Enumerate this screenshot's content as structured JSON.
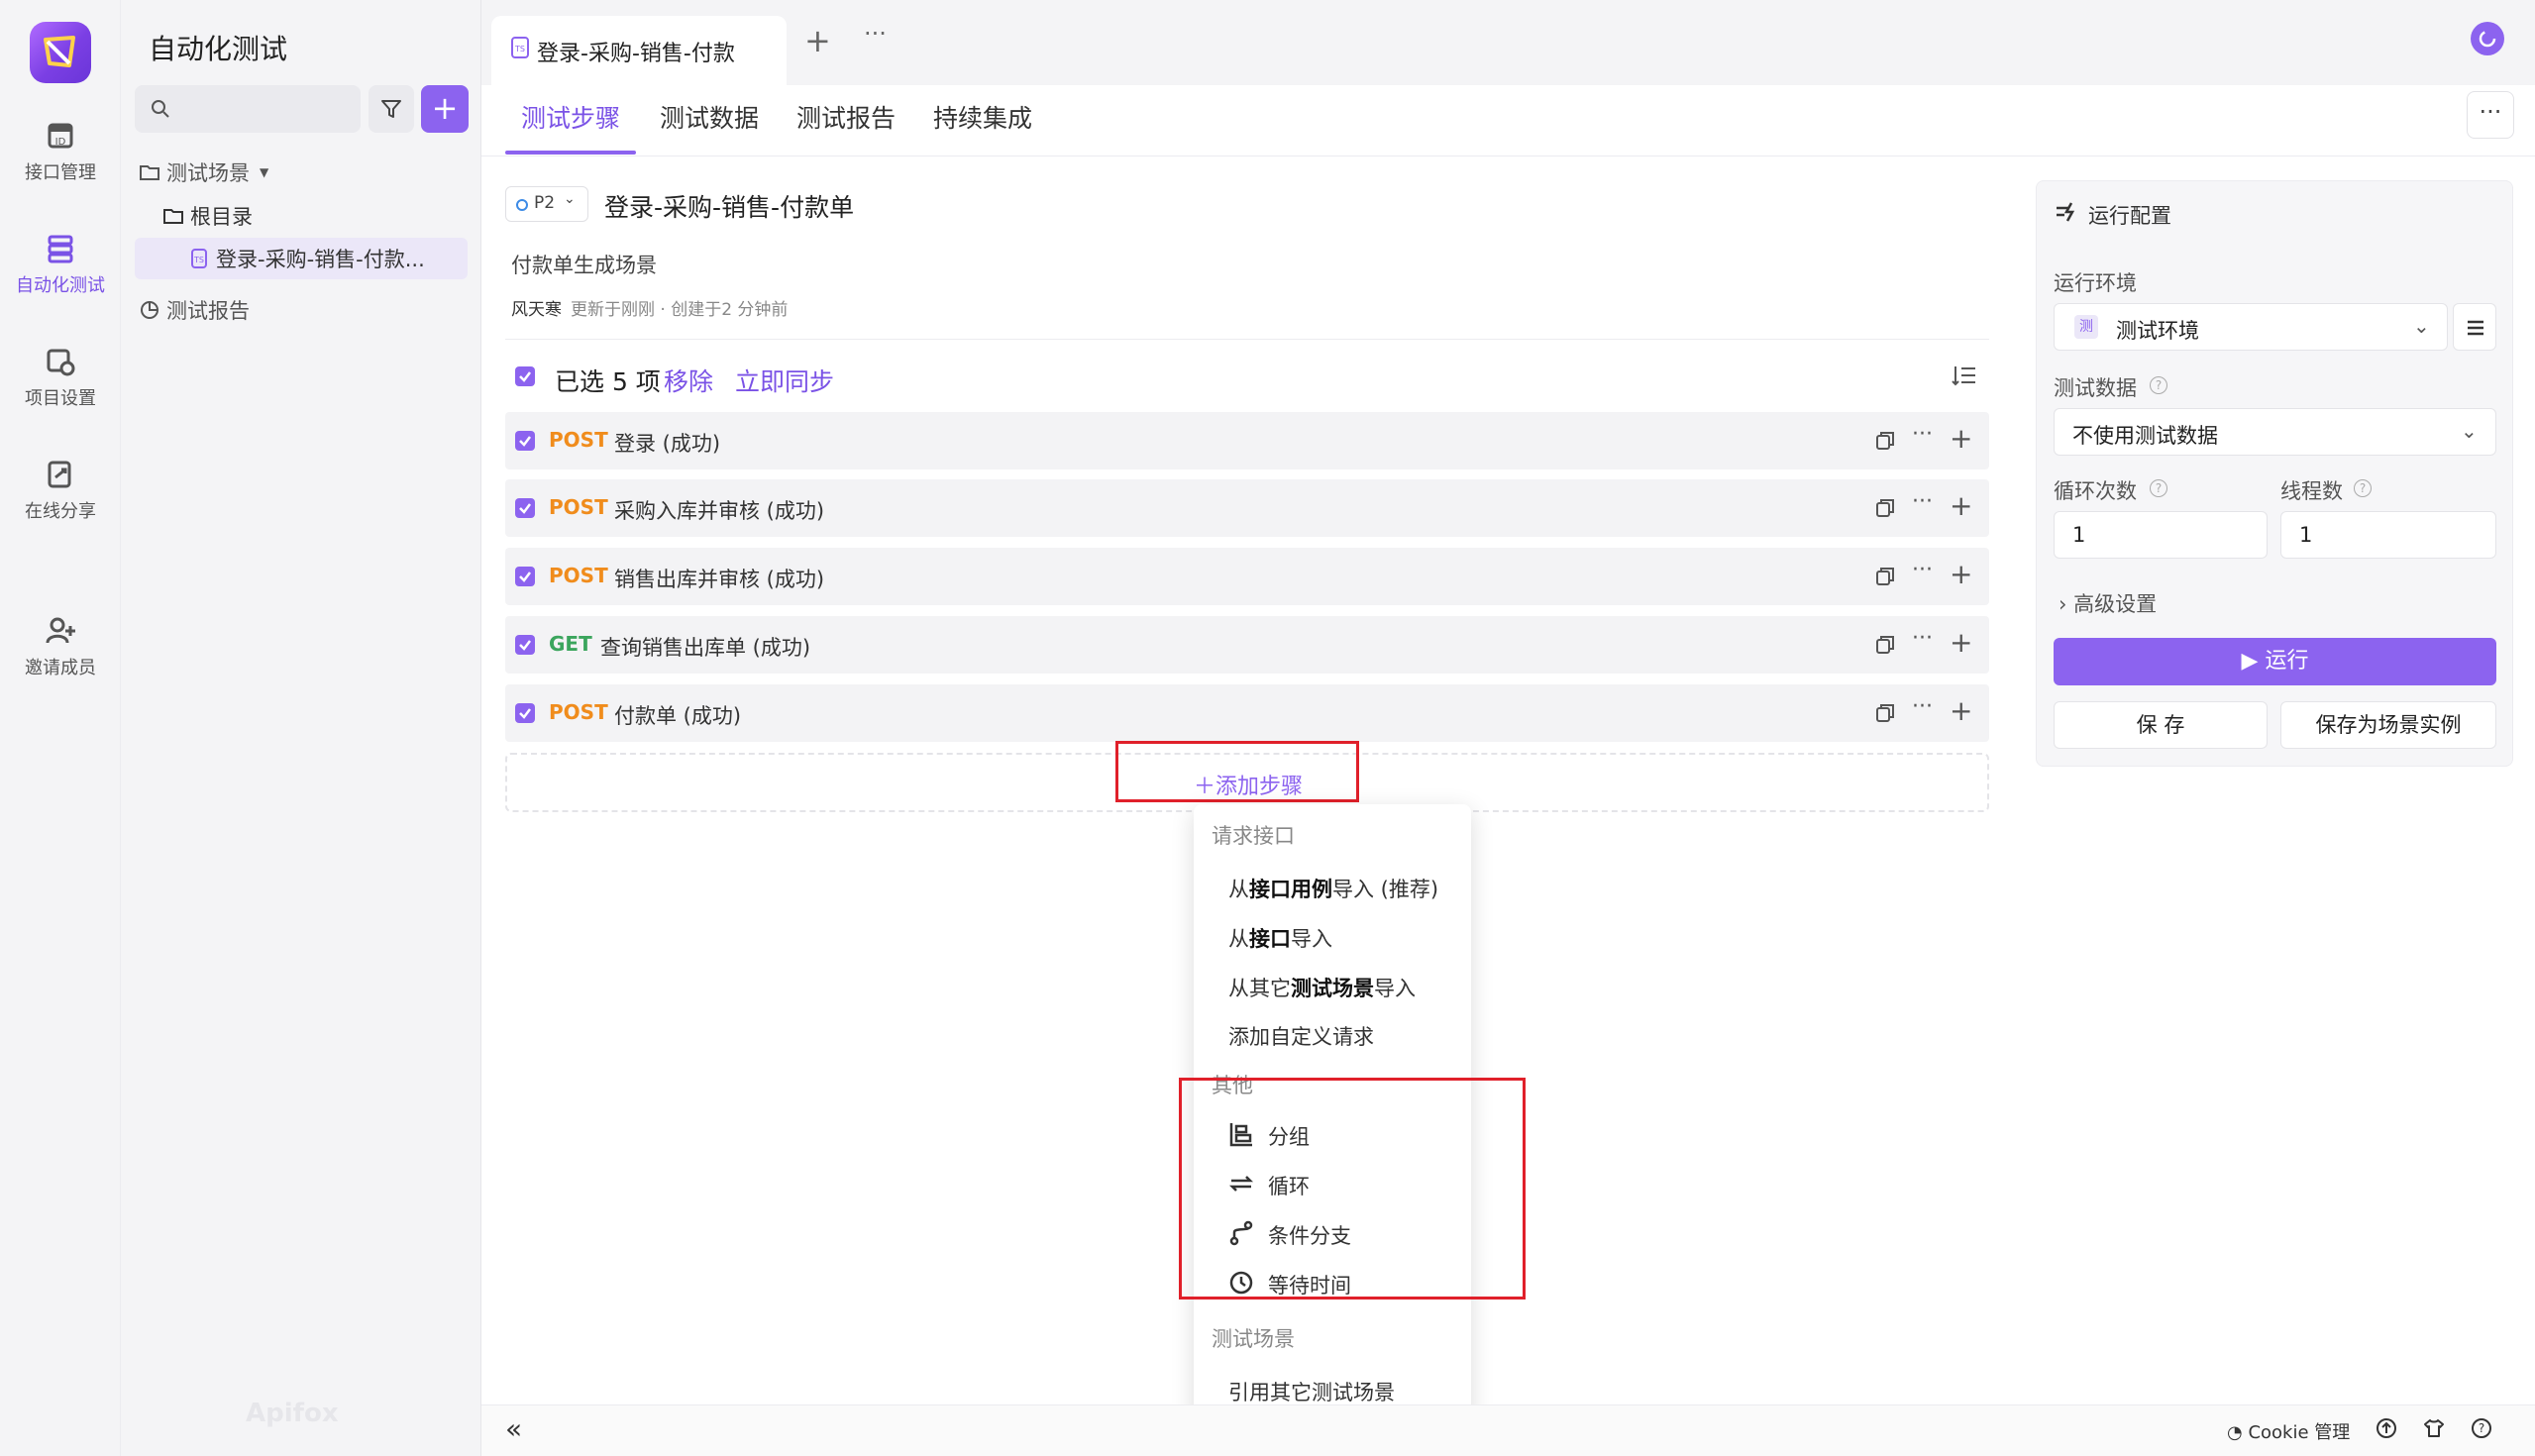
{
  "rail": {
    "items": [
      {
        "label": "接口管理"
      },
      {
        "label": "自动化测试"
      },
      {
        "label": "项目设置"
      },
      {
        "label": "在线分享"
      },
      {
        "label": "邀请成员"
      }
    ]
  },
  "tree": {
    "title": "自动化测试",
    "search_placeholder": "",
    "items": [
      {
        "label": "测试场景"
      },
      {
        "label": "根目录"
      },
      {
        "label": "登录-采购-销售-付款..."
      },
      {
        "label": "测试报告"
      }
    ],
    "watermark": "Apifox"
  },
  "tabs": {
    "open_tab": "登录-采购-销售-付款",
    "add": "+",
    "more": "···"
  },
  "subtabs": [
    "测试步骤",
    "测试数据",
    "测试报告",
    "持续集成"
  ],
  "scenario": {
    "priority": "P2",
    "title": "登录-采购-销售-付款单",
    "description": "付款单生成场景",
    "author": "风天寒",
    "meta": "更新于刚刚 · 创建于2 分钟前"
  },
  "selection": {
    "text": "已选 5 项",
    "remove": "移除",
    "sync": "立即同步"
  },
  "steps": [
    {
      "method": "POST",
      "name": "登录 (成功)"
    },
    {
      "method": "POST",
      "name": "采购入库并审核 (成功)"
    },
    {
      "method": "POST",
      "name": "销售出库并审核 (成功)"
    },
    {
      "method": "GET",
      "name": "查询销售出库单 (成功)"
    },
    {
      "method": "POST",
      "name": "付款单 (成功)"
    }
  ],
  "add_step": "＋添加步骤",
  "menu": {
    "section1": "请求接口",
    "i1_pre": "从",
    "i1_b": "接口用例",
    "i1_post": "导入 (推荐)",
    "i2_pre": "从",
    "i2_b": "接口",
    "i2_post": "导入",
    "i3_pre": "从其它",
    "i3_b": "测试场景",
    "i3_post": "导入",
    "i4": "添加自定义请求",
    "section2": "其他",
    "group": "分组",
    "loop": "循环",
    "branch": "条件分支",
    "wait": "等待时间",
    "section3": "测试场景",
    "ref": "引用其它测试场景"
  },
  "config": {
    "title": "运行配置",
    "env_label": "运行环境",
    "env_badge": "测",
    "env_value": "测试环境",
    "data_label": "测试数据",
    "data_value": "不使用测试数据",
    "loop_label": "循环次数",
    "loop_value": "1",
    "thread_label": "线程数",
    "thread_value": "1",
    "advanced": "高级设置",
    "run": "运行",
    "save": "保 存",
    "save_instance": "保存为场景实例"
  },
  "status": {
    "collapse": "«",
    "cookie": "Cookie 管理"
  },
  "colors": {
    "accent": "#8c63ef",
    "post": "#f08c1c",
    "get": "#3ba55d",
    "highlight": "#e0202a"
  }
}
